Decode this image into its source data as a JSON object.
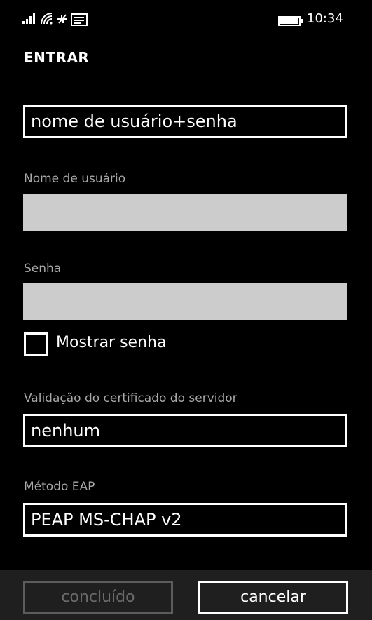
{
  "status_bar": {
    "icons": [
      "signal-icon",
      "wifi-icon",
      "data-icon",
      "message-icon",
      "battery-icon"
    ],
    "time": "10:34"
  },
  "page": {
    "title": "ENTRAR"
  },
  "form": {
    "auth_type": {
      "value": "nome de usuário+senha"
    },
    "username": {
      "label": "Nome de usuário",
      "value": ""
    },
    "password": {
      "label": "Senha",
      "value": ""
    },
    "show_password": {
      "label": "Mostrar senha",
      "checked": false
    },
    "cert_validation": {
      "label": "Validação do certificado do servidor",
      "value": "nenhum"
    },
    "eap_method": {
      "label": "Método EAP",
      "value": "PEAP MS-CHAP v2"
    }
  },
  "app_bar": {
    "done_label": "concluído",
    "cancel_label": "cancelar"
  },
  "colors": {
    "background": "#000000",
    "input_fill": "#cccccc",
    "label_gray": "#a8a8a8",
    "disabled": "#5c5c5c"
  }
}
